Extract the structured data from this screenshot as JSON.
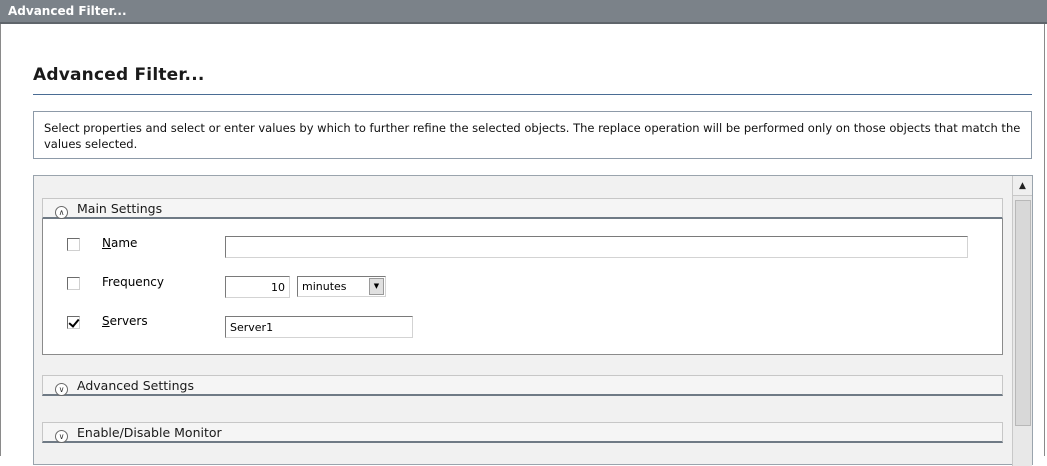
{
  "window": {
    "title": "Advanced Filter..."
  },
  "page": {
    "title": "Advanced Filter...",
    "description": "Select properties and select or enter values by which to further refine the selected objects. The replace operation will be performed only on those objects that match the values selected."
  },
  "sections": {
    "main": {
      "label": "Main Settings",
      "expanded": true
    },
    "advanced": {
      "label": "Advanced Settings",
      "expanded": false
    },
    "enable_disable": {
      "label": "Enable/Disable Monitor",
      "expanded": false
    }
  },
  "fields": {
    "name": {
      "label_access": "N",
      "label_rest": "ame",
      "checked": false,
      "value": ""
    },
    "frequency": {
      "label": "Frequency",
      "checked": false,
      "value": "10",
      "unit": "minutes"
    },
    "servers": {
      "label_access": "S",
      "label_rest": "ervers",
      "checked": true,
      "value": "Server1"
    }
  },
  "icons": {
    "collapse": "chevron-double-up-icon",
    "expand": "chevron-double-down-icon",
    "scroll_up": "arrow-up-icon",
    "dropdown": "arrow-down-icon"
  }
}
